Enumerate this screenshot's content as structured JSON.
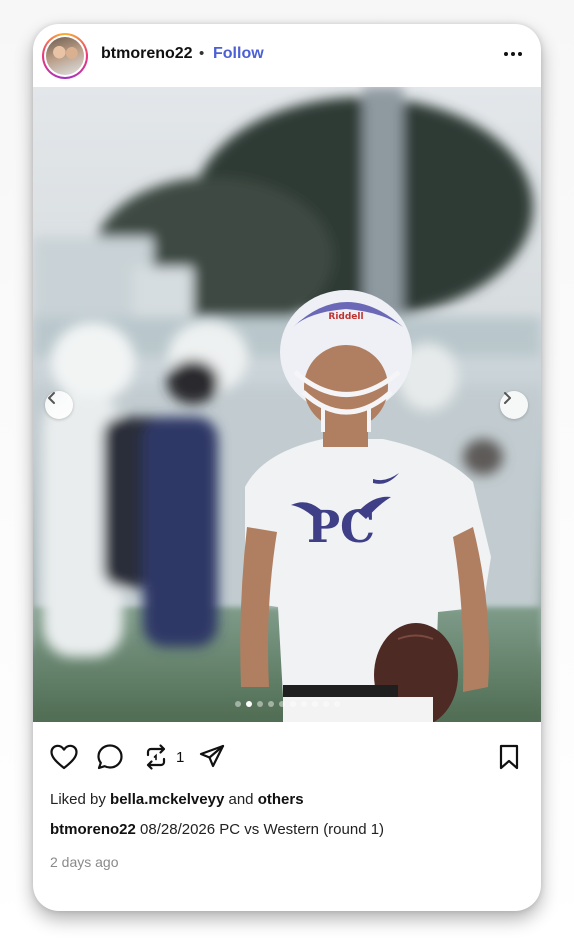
{
  "post": {
    "username": "btmoreno22",
    "separator": "•",
    "follow_label": "Follow",
    "more_icon": "more-horizontal-icon",
    "image": {
      "alt_icon": "photo",
      "helmet_brand": "Riddell",
      "shirt_text": "PC",
      "slide_count": 10,
      "active_slide": 1
    },
    "actions": {
      "repost_count": "1"
    },
    "likes": {
      "prefix": "Liked by",
      "user": "bella.mckelveyy",
      "middle": "and",
      "others": "others"
    },
    "caption": {
      "user": "btmoreno22",
      "text": "08/28/2026 PC vs Western (round 1)"
    },
    "time_ago": "2 days ago"
  },
  "colors": {
    "follow": "#4c5fd5",
    "text": "#111111",
    "muted": "#8a8a8a",
    "jersey_accent": "#3e3f86"
  }
}
